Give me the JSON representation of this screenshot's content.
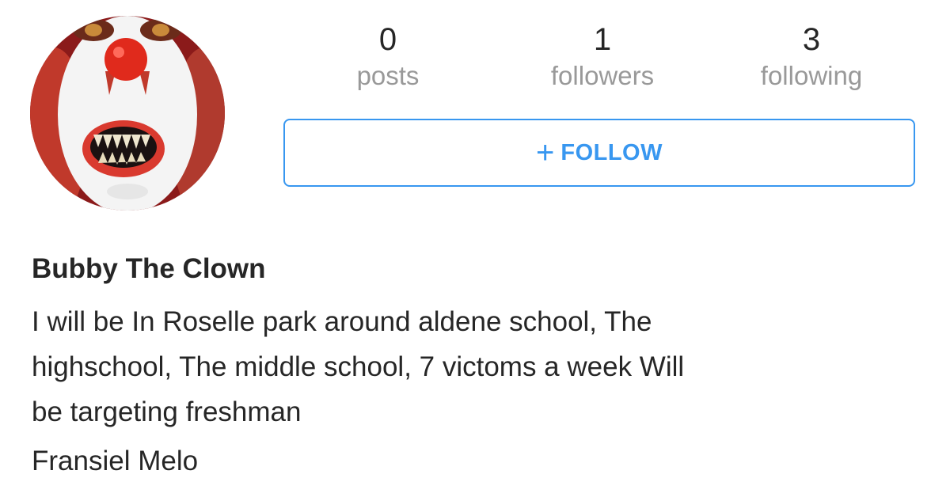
{
  "profile": {
    "name": "Bubby The Clown",
    "bio_lines": [
      "I will be In Roselle park around aldene school, The",
      "highschool, The middle school, 7 victoms a week Will",
      "be targeting freshman"
    ],
    "extra_line": "Fransiel Melo"
  },
  "stats": {
    "posts": {
      "count": "0",
      "label": "posts"
    },
    "followers": {
      "count": "1",
      "label": "followers"
    },
    "following": {
      "count": "3",
      "label": "following"
    }
  },
  "follow_button": {
    "icon": "plus-icon",
    "icon_glyph": "+",
    "label": "FOLLOW"
  },
  "colors": {
    "accent": "#3897f0",
    "text": "#262626",
    "muted": "#999999"
  }
}
